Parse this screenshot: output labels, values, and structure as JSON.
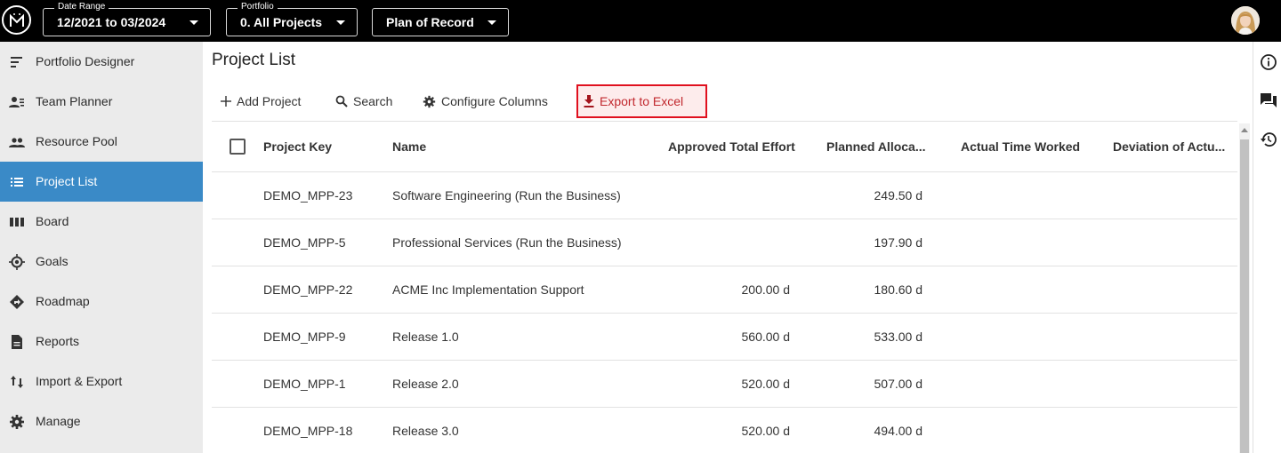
{
  "topbar": {
    "date_range": {
      "label": "Date Range",
      "value": "12/2021 to 03/2024"
    },
    "portfolio": {
      "label": "Portfolio",
      "value": "0. All Projects"
    },
    "plan": {
      "value": "Plan of Record"
    }
  },
  "sidebar": {
    "items": [
      {
        "label": "Portfolio Designer",
        "icon": "portfolio-designer-icon"
      },
      {
        "label": "Team Planner",
        "icon": "team-planner-icon"
      },
      {
        "label": "Resource Pool",
        "icon": "people-icon"
      },
      {
        "label": "Project List",
        "icon": "list-icon",
        "active": true
      },
      {
        "label": "Board",
        "icon": "board-icon"
      },
      {
        "label": "Goals",
        "icon": "target-icon"
      },
      {
        "label": "Roadmap",
        "icon": "roadmap-icon"
      },
      {
        "label": "Reports",
        "icon": "document-icon"
      },
      {
        "label": "Import & Export",
        "icon": "import-export-icon"
      },
      {
        "label": "Manage",
        "icon": "gear-icon"
      }
    ]
  },
  "main": {
    "title": "Project List",
    "toolbar": {
      "add_label": "Add Project",
      "search_label": "Search",
      "configure_label": "Configure Columns",
      "export_label": "Export to Excel"
    },
    "columns": [
      "Project Key",
      "Name",
      "Approved Total Effort",
      "Planned Alloca...",
      "Actual Time Worked",
      "Deviation of Actu..."
    ],
    "rows": [
      {
        "key": "DEMO_MPP-23",
        "name": "Software Engineering (Run the Business)",
        "approved": "",
        "planned": "249.50 d"
      },
      {
        "key": "DEMO_MPP-5",
        "name": "Professional Services (Run the Business)",
        "approved": "",
        "planned": "197.90 d"
      },
      {
        "key": "DEMO_MPP-22",
        "name": "ACME Inc Implementation Support",
        "approved": "200.00 d",
        "planned": "180.60 d"
      },
      {
        "key": "DEMO_MPP-9",
        "name": "Release 1.0",
        "approved": "560.00 d",
        "planned": "533.00 d"
      },
      {
        "key": "DEMO_MPP-1",
        "name": "Release 2.0",
        "approved": "520.00 d",
        "planned": "507.00 d"
      },
      {
        "key": "DEMO_MPP-18",
        "name": "Release 3.0",
        "approved": "520.00 d",
        "planned": "494.00 d"
      }
    ]
  },
  "rail": {
    "icons": [
      "info-icon",
      "comments-icon",
      "history-icon"
    ]
  },
  "colors": {
    "topbar": "#000000",
    "sidebar": "#ebebeb",
    "active": "#3a8ac7",
    "export_border": "#e0101e",
    "export_bg": "#fdecec"
  }
}
